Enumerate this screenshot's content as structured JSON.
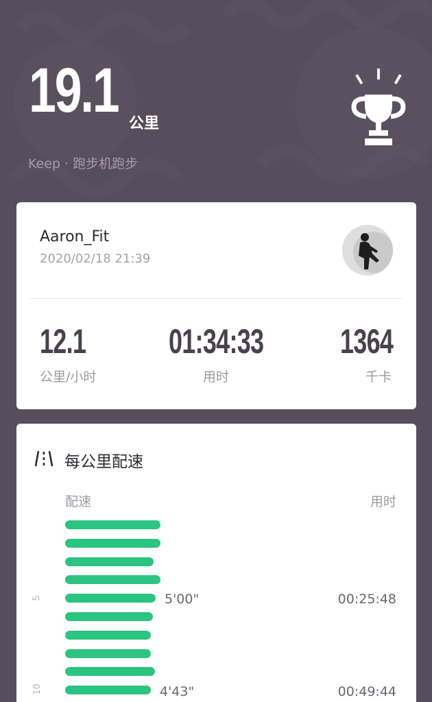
{
  "summary": {
    "distance": "19.1",
    "distance_unit": "公里",
    "subtitle": "Keep · 跑步机跑步"
  },
  "user": {
    "name": "Aaron_Fit",
    "datetime": "2020/02/18 21:39"
  },
  "stats": {
    "speed_value": "12.1",
    "speed_label": "公里/小时",
    "duration_value": "01:34:33",
    "duration_label": "用时",
    "calories_value": "1364",
    "calories_label": "千卡"
  },
  "pace": {
    "title": "每公里配速",
    "col_pace": "配速",
    "col_time": "用时",
    "marker_5": "5",
    "marker_10": "10",
    "row5_pace": "5'00\"",
    "row5_time": "00:25:48",
    "row10_pace": "4'43\"",
    "row10_time": "00:49:44",
    "bar_fractions": [
      0.98,
      0.98,
      0.91,
      0.98,
      0.93,
      0.9,
      0.88,
      0.88,
      0.92,
      0.88
    ],
    "bar_color": "#2bc480"
  },
  "icons": {
    "trophy": "trophy-icon",
    "pace": "pace-lanes-icon",
    "avatar": "avatar"
  }
}
